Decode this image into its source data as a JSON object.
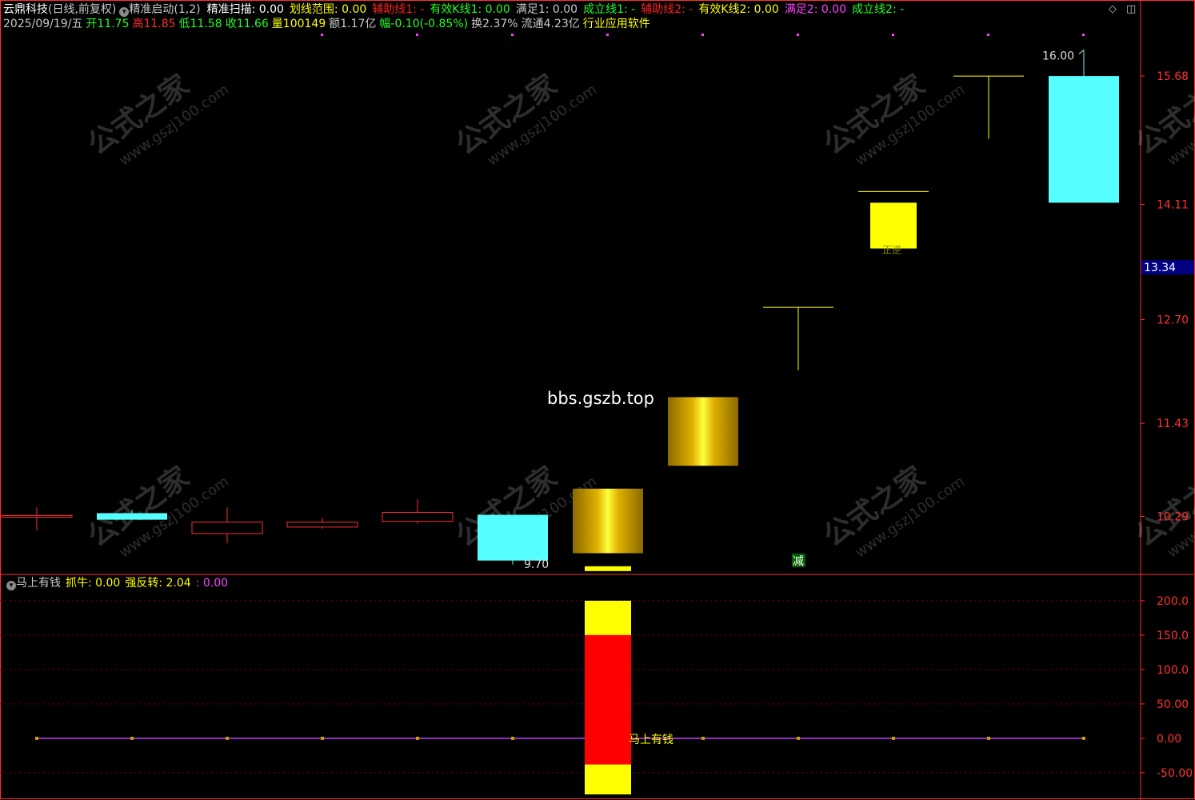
{
  "header": {
    "stock_name": "云鼎科技",
    "period": "(日线,前复权)",
    "indicator1_name": "精准启动",
    "indicator1_params": "(1,2)",
    "items": [
      {
        "label": "精准扫描: 0.00",
        "color": "#ffffff"
      },
      {
        "label": "划线范围: 0.00",
        "color": "#ffff00"
      },
      {
        "label": "辅助线1: -",
        "color": "#ff2020"
      },
      {
        "label": "有效K线1: 0.00",
        "color": "#20ff20"
      },
      {
        "label": "满足1: 0.00",
        "color": "#c8c8c8"
      },
      {
        "label": "成立线1: -",
        "color": "#20ff20"
      },
      {
        "label": "辅助线2: -",
        "color": "#ff2020"
      },
      {
        "label": "有效K线2: 0.00",
        "color": "#ffff00"
      },
      {
        "label": "满足2: 0.00",
        "color": "#ff40ff"
      },
      {
        "label": "成立线2: -",
        "color": "#20ff20"
      }
    ],
    "quote": [
      {
        "label": "2025/09/19/五",
        "color": "#c8c8c8"
      },
      {
        "label": "开11.75",
        "color": "#20ff20"
      },
      {
        "label": "高11.85",
        "color": "#ff3030"
      },
      {
        "label": "低11.58",
        "color": "#20ff20"
      },
      {
        "label": "收11.66",
        "color": "#20ff20"
      },
      {
        "label": "量100149",
        "color": "#ffff00"
      },
      {
        "label": "额1.17亿",
        "color": "#c8c8c8"
      },
      {
        "label": "幅-0.10(-0.85%)",
        "color": "#20ff20"
      },
      {
        "label": "换2.37%",
        "color": "#c8c8c8"
      },
      {
        "label": "流通4.23亿",
        "color": "#c8c8c8"
      },
      {
        "label": "行业应用软件",
        "color": "#ffff00"
      }
    ],
    "lower_indicator_name": "马上有钱",
    "lower_items": [
      {
        "label": "抓牛: 0.00",
        "color": "#ffff00"
      },
      {
        "label": "强反转: 2.04",
        "color": "#ffff00"
      },
      {
        "label": ": 0.00",
        "color": "#ff40ff"
      }
    ]
  },
  "icons": [
    "diamond-icon",
    "square-icon",
    "dropdown-icon"
  ],
  "watermark": {
    "text1": "公式之家",
    "text2": "www.gszj100.com",
    "site": "bbs.gszb.top"
  },
  "colors": {
    "up": "#ff3030",
    "down": "#55ffff",
    "signal": "#ffff00",
    "gold": "#d4a000",
    "grid": "#800000",
    "axis": "#ff3030"
  },
  "chart_data": [
    {
      "type": "candlestick",
      "panel": "upper",
      "ylim": [
        9.6,
        16.2
      ],
      "yticks": [
        "15.68",
        "14.11",
        "12.70",
        "11.43",
        "10.29"
      ],
      "ytick_values": [
        15.68,
        14.11,
        12.7,
        11.43,
        10.29
      ],
      "current_price_label": "13.34",
      "current_price": 13.34,
      "candles": [
        {
          "o": 10.28,
          "h": 10.4,
          "l": 10.12,
          "c": 10.3,
          "style": "up-hollow"
        },
        {
          "o": 10.33,
          "h": 10.37,
          "l": 10.26,
          "c": 10.25,
          "style": "down"
        },
        {
          "o": 10.08,
          "h": 10.4,
          "l": 9.96,
          "c": 10.22,
          "style": "up-hollow"
        },
        {
          "o": 10.16,
          "h": 10.27,
          "l": 10.14,
          "c": 10.22,
          "style": "up-hollow"
        },
        {
          "o": 10.23,
          "h": 10.5,
          "l": 10.2,
          "c": 10.34,
          "style": "up-hollow"
        },
        {
          "o": 10.31,
          "h": 10.31,
          "l": 9.7,
          "c": 9.75,
          "style": "down"
        },
        {
          "o": 9.84,
          "h": 10.63,
          "l": 9.81,
          "c": 10.63,
          "style": "gold"
        },
        {
          "o": 10.91,
          "h": 11.75,
          "l": 10.91,
          "c": 11.75,
          "style": "gold"
        },
        {
          "o": 12.85,
          "h": 12.85,
          "l": 12.08,
          "c": 12.85,
          "style": "yellow-line"
        },
        {
          "o": 13.57,
          "h": 14.13,
          "l": 13.57,
          "c": 14.13,
          "style": "yellow"
        },
        {
          "o": 15.68,
          "h": 15.68,
          "l": 14.91,
          "c": 15.68,
          "style": "yellow-line"
        },
        {
          "o": 15.68,
          "h": 16.0,
          "l": 14.13,
          "c": 14.13,
          "style": "down"
        }
      ],
      "annotations": [
        {
          "text": "16.00",
          "candle": 11,
          "value": 16.0
        },
        {
          "text": "9.70",
          "candle": 5,
          "value": 9.7
        },
        {
          "text": "减",
          "candle": 8,
          "value": 9.68
        },
        {
          "text": "正逆",
          "candle": 9,
          "value": 13.57
        }
      ]
    },
    {
      "type": "bar",
      "panel": "lower",
      "ylim": [
        -85,
        215
      ],
      "yticks": [
        "200.0",
        "150.0",
        "100.0",
        "50.00",
        "0.00",
        "-50.00"
      ],
      "ytick_values": [
        200,
        150,
        100,
        50,
        0,
        -50
      ],
      "label": "马上有钱",
      "bar": {
        "candle": 6,
        "segments": [
          {
            "from": 150,
            "to": 200,
            "color": "#ffff00"
          },
          {
            "from": -38,
            "to": 150,
            "color": "#ff0000"
          },
          {
            "from": -100,
            "to": -38,
            "color": "#ffff00"
          }
        ]
      },
      "zero_line_value": 0
    }
  ]
}
